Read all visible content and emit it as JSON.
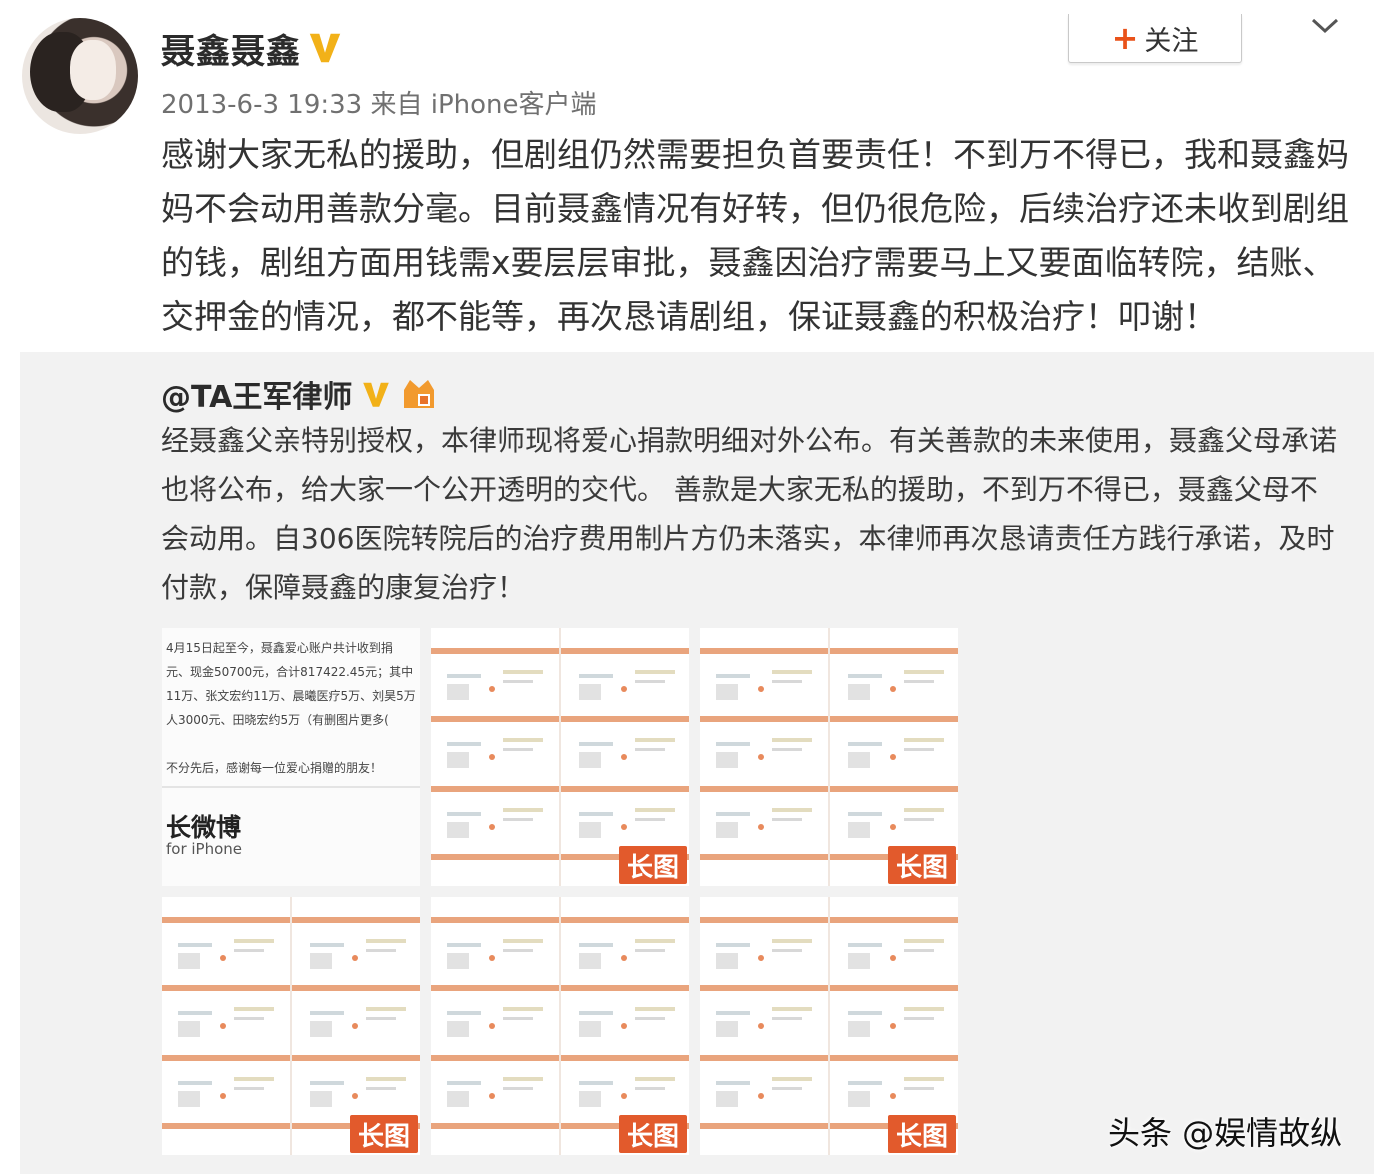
{
  "post": {
    "author": "聂鑫聂鑫",
    "timestamp": "2013-6-3 19:33",
    "source": "来自 iPhone客户端",
    "follow_label": "关注",
    "follow_plus": "+",
    "text": "感谢大家无私的援助，但剧组仍然需要担负首要责任！不到万不得已，我和聂鑫妈妈不会动用善款分毫。目前聂鑫情况有好转，但仍很危险，后续治疗还未收到剧组的钱，剧组方面用钱需x要层层审批，聂鑫因治疗需要马上又要面临转院，结账、交押金的情况，都不能等，再次恳请剧组，保证聂鑫的积极治疗！叩谢！",
    "icons": {
      "verified": "verified-v-icon",
      "menu": "chevron-down-icon"
    },
    "colors": {
      "verified": "#f2b118",
      "follow_plus": "#e9521a"
    }
  },
  "repost": {
    "author": "@TA王军律师",
    "text": "经聂鑫父亲特别授权，本律师现将爱心捐款明细对外公布。有关善款的未来使用，聂鑫父母承诺也将公布，给大家一个公开透明的交代。 善款是大家无私的援助，不到万不得已，聂鑫父母不会动用。自306医院转院后的治疗费用制片方仍未落实，本律师再次恳请责任方践行承诺，及时付款，保障聂鑫的康复治疗！",
    "icons": {
      "verified": "verified-v-icon",
      "member": "member-crown-icon"
    },
    "doc_thumb": {
      "lines": [
        "4月15日起至今，聂鑫爱心账户共计收到捐",
        "元、现金50700元，合计817422.45元；其中",
        "11万、张文宏约11万、晨曦医疗5万、刘昊5万",
        "人3000元、田晓宏约5万（有删图片更多(",
        "",
        "不分先后，感谢每一位爱心捐赠的朋友！"
      ],
      "title": "长微博",
      "subtitle": "for iPhone"
    },
    "long_image_badge": "长图"
  },
  "watermark": "头条 @娱情故纵"
}
